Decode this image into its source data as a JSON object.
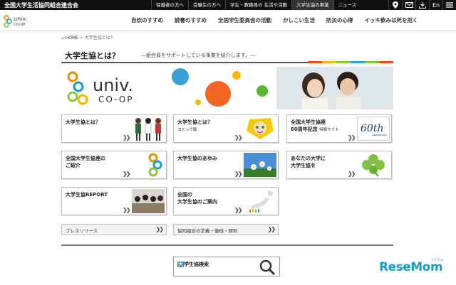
{
  "topbar": {
    "org_name": "全国大学生活協同組合連合会",
    "links": [
      {
        "label": "保護者の方へ"
      },
      {
        "label": "受験生の方へ"
      },
      {
        "label": "学生・教職員の 生活や活動"
      },
      {
        "label": "大学生協の事業"
      },
      {
        "label": "ニュース"
      }
    ],
    "lang_label": "En"
  },
  "nav": {
    "items": [
      "自炊のすすめ",
      "読書のすすめ",
      "全国学生委員会の活動",
      "かしこい生活",
      "防災の心得",
      "イッキ飲みは死を招く"
    ]
  },
  "logo": {
    "line1": "univ.",
    "line2": "CO-OP"
  },
  "breadcrumb": {
    "home": "HOME",
    "current": "大学生協とは？"
  },
  "page": {
    "title": "大学生協とは？",
    "subtitle": "―組合員をサポートしている事業を紹介します。―"
  },
  "cards": [
    {
      "title": "大学生協とは？",
      "sub": ""
    },
    {
      "title": "大学生協とは？",
      "sub": "コミック版"
    },
    {
      "title": "全国大学生協連\n60周年記念",
      "sub": "特設サイト"
    },
    {
      "title": "全国大学生協連の\nご紹介",
      "sub": ""
    },
    {
      "title": "大学生協のあゆみ",
      "sub": ""
    },
    {
      "title": "あなたの大学に\n大学生協を",
      "sub": ""
    },
    {
      "title": "大学生協REPORT",
      "sub": ""
    },
    {
      "title": "全国の\n大学生協のご案内",
      "sub": ""
    }
  ],
  "badge_60": {
    "big": "60th",
    "small": "ANNIVERSARY"
  },
  "slim_links": [
    {
      "label": "プレスリリース"
    },
    {
      "label": "協同組合の定義・価値・原則"
    }
  ],
  "search": {
    "key_char": "大",
    "rest": "学生協検索"
  },
  "watermark": {
    "main": "ReseMom",
    "sub": "リセマム"
  },
  "colors": {
    "topbar_bg": "#111111",
    "accent_blue": "#1a9cc4",
    "stripe_colors": [
      "#e94e1b",
      "#f6b800",
      "#8cc63f",
      "#3aa0d8",
      "#7fc241",
      "#e94e1b"
    ]
  }
}
